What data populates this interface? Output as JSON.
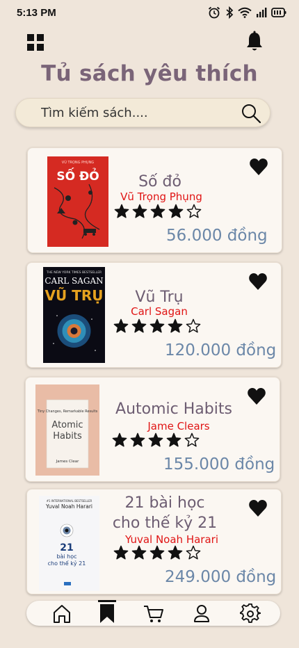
{
  "status_bar": {
    "time": "5:13 PM"
  },
  "header": {
    "title": "Tủ sách yêu thích"
  },
  "search": {
    "placeholder": "Tìm kiếm sách...."
  },
  "books": [
    {
      "title": "Số đỏ",
      "author": "Vũ Trọng Phụng",
      "rating": 4,
      "max_rating": 5,
      "price": "56.000 đồng",
      "cover_text": "SỐ ĐỎ",
      "favorite": true
    },
    {
      "title": "Vũ Trụ",
      "author": "Carl Sagan",
      "rating": 4,
      "max_rating": 5,
      "price": "120.000 đồng",
      "cover_top": "CARL SAGAN",
      "cover_text": "VŨ TRỤ",
      "favorite": true
    },
    {
      "title": "Automic Habits",
      "author": "Jame Clears",
      "rating": 4,
      "max_rating": 5,
      "price": "155.000 đồng",
      "cover_sub": "Tiny Changes, Remarkable Results",
      "cover_text_1": "Atomic",
      "cover_text_2": "Habits",
      "cover_author": "James Clear",
      "favorite": true
    },
    {
      "title_line1": "21 bài học",
      "title_line2": "cho thế kỷ 21",
      "author": "Yuval Noah Harari",
      "rating": 4,
      "max_rating": 5,
      "price": "249.000 đồng",
      "cover_author": "Yuval Noah Harari",
      "cover_num": "21",
      "cover_line1": "bài học",
      "cover_line2": "cho thế kỷ 21",
      "favorite": true
    }
  ],
  "nav": {
    "items": [
      "home-icon",
      "bookmark-icon",
      "cart-icon",
      "profile-icon",
      "settings-icon"
    ],
    "active": "bookmark-icon"
  },
  "colors": {
    "background": "#efe5da",
    "title": "#7a6478",
    "author": "#e01414",
    "price": "#6b87a8"
  }
}
